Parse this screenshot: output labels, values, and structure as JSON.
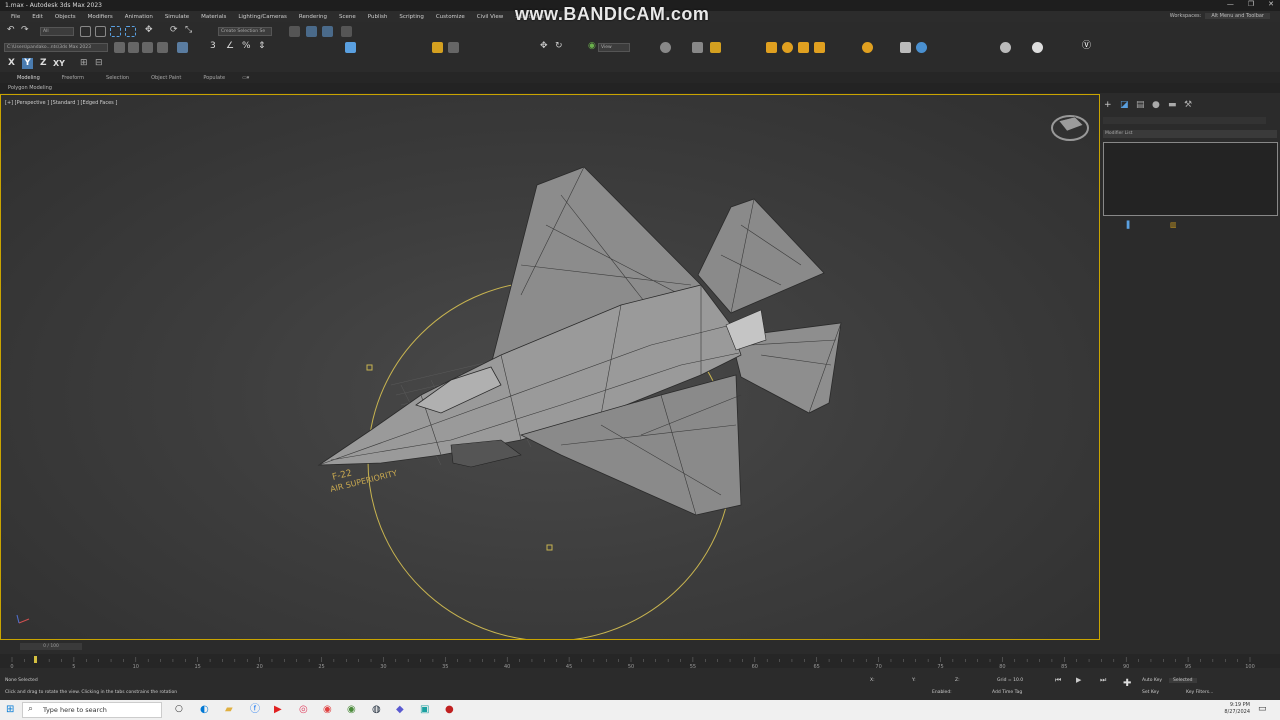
{
  "window": {
    "title": "1.max - Autodesk 3ds Max 2023",
    "watermark": "www.BANDICAM.com",
    "controls": [
      "—",
      "❐",
      "✕"
    ]
  },
  "menu": {
    "items": [
      "File",
      "Edit",
      "Objects",
      "Modifiers",
      "Animation",
      "Simulate",
      "Materials",
      "Lighting/Cameras",
      "Rendering",
      "Scene",
      "Publish",
      "Scripting",
      "Customize",
      "Civil View",
      "Substance"
    ],
    "workspaces_label": "Workspaces:",
    "workspaces_value": "Alt Menu and Toolbar"
  },
  "toolbar": {
    "selection_filter": "All",
    "create_selection_set": "Create Selection Se",
    "project_path": "C:\\Users\\pandako...nts\\3ds Max 2023",
    "view_dropdown": "View",
    "axis_buttons": [
      "X",
      "Y",
      "Z",
      "XY"
    ]
  },
  "ribbon": {
    "tabs": [
      "Modeling",
      "Freeform",
      "Selection",
      "Object Paint",
      "Populate"
    ],
    "active_tab": "Modeling",
    "sub_label": "Polygon Modeling"
  },
  "viewport": {
    "label": "[+] [Perspective ] [Standard ] [Edged Faces ]",
    "decal_line1": "F-22",
    "decal_line2": "AIR SUPERIORITY"
  },
  "command_panel": {
    "modifier_list": "Modifier List"
  },
  "timeline": {
    "frame_indicator": "0 / 100",
    "ticks": [
      "0",
      "5",
      "10",
      "15",
      "20",
      "25",
      "30",
      "35",
      "40",
      "45",
      "50",
      "55",
      "60",
      "65",
      "70",
      "75",
      "80",
      "85",
      "90",
      "95",
      "100"
    ]
  },
  "status": {
    "selection": "None Selected",
    "prompt": "Click and drag to rotate the view.  Clicking in the tabs constrains the rotation",
    "x_label": "X:",
    "y_label": "Y:",
    "z_label": "Z:",
    "grid": "Grid = 10.0",
    "enabled": "Enabled:",
    "add_time_tag": "Add Time Tag",
    "auto_key": "Auto Key",
    "set_key": "Set Key",
    "selected": "Selected",
    "key_filters": "Key Filters..."
  },
  "taskbar": {
    "search_placeholder": "Type here to search",
    "time": "9:19 PM",
    "date": "8/27/2024"
  }
}
